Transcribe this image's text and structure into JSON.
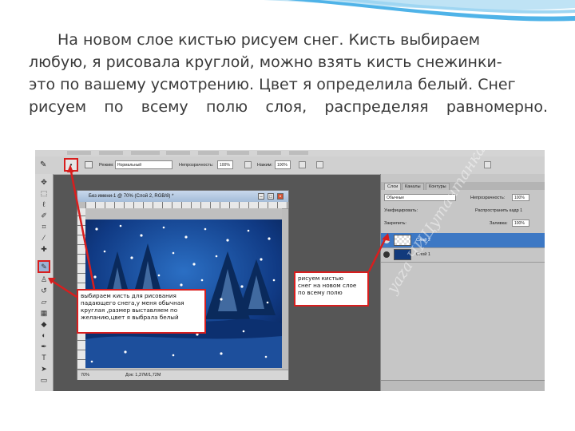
{
  "slide": {
    "paragraph_lines": [
      "На новом слое кистью рисуем снег. Кисть выбираем",
      "любую, я рисовала круглой, можно взять кисть снежинки-",
      "это по вашему усмотрению. Цвет я определила белый. Снег",
      "рисуем по всему полю слоя, распределяя равномерно."
    ],
    "accent_color": "#4fb3e8"
  },
  "photoshop": {
    "options_bar": {
      "mode_label": "Режим:",
      "mode_value": "Нормальный",
      "opacity_label": "Непрозрачность:",
      "opacity_value": "100%",
      "pressure_label": "Нажим:",
      "pressure_value": "100%"
    },
    "document": {
      "title": "Без имени-1 @ 70% (Слой 2, RGB/8) *",
      "zoom": "70%",
      "doc_info": "Док: 1,37M/1,72M"
    },
    "panel": {
      "tabs": [
        "Слои",
        "Каналы",
        "Контуры"
      ],
      "blend_mode": "Обычные",
      "opacity_label": "Непрозрачность:",
      "opacity_value": "100%",
      "unify_label": "Унифицировать:",
      "propagate_label": "Распространить кадр 1",
      "lock_label": "Закрепить:",
      "fill_label": "Заливка:",
      "fill_value": "100%",
      "layers": [
        {
          "name": "Слой 2",
          "selected": true
        },
        {
          "name": "Слой 1",
          "selected": false
        }
      ]
    },
    "toolbar_icons": [
      "move-icon",
      "marquee-icon",
      "lasso-icon",
      "quick-select-icon",
      "crop-icon",
      "eyedropper-icon",
      "healing-icon",
      "brush-icon",
      "stamp-icon",
      "history-brush-icon",
      "eraser-icon",
      "gradient-icon",
      "blur-icon",
      "dodge-icon",
      "pen-icon",
      "type-icon",
      "path-select-icon",
      "shape-icon"
    ],
    "active_tool": "brush-icon"
  },
  "callouts": {
    "brush": [
      "выбираем кисть для рисования",
      "падающего снега,у меня обычная",
      "круглая ,размер выставляем по",
      "желанию,цвет я выбрала белый"
    ],
    "layer": [
      "рисуем кистью",
      "снег на новом слое",
      "по всему полю"
    ],
    "border_color": "#d81e1e"
  },
  "watermark": "yaza ЧИЦутантанка"
}
